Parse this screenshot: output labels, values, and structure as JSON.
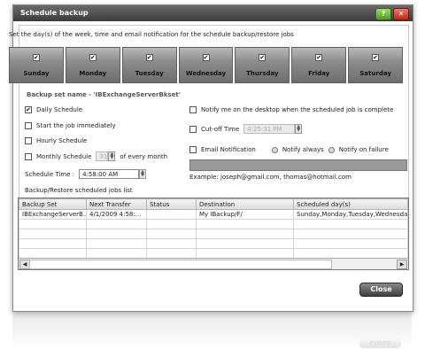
{
  "window": {
    "title": "Schedule backup",
    "help_label": "?",
    "close_label": "✕"
  },
  "intro": "Set the day(s) of the week, time and email notification for the schedule backup/restore jobs",
  "days": [
    {
      "label": "Sunday",
      "checked": true
    },
    {
      "label": "Monday",
      "checked": true
    },
    {
      "label": "Tuesday",
      "checked": true
    },
    {
      "label": "Wednesday",
      "checked": true
    },
    {
      "label": "Thursday",
      "checked": true
    },
    {
      "label": "Friday",
      "checked": true
    },
    {
      "label": "Saturday",
      "checked": true
    }
  ],
  "backup_set_name": "Backup set name - 'IBExchangeServerBkset'",
  "left_options": {
    "daily": {
      "label": "Daily Schedule",
      "checked": true
    },
    "immediately": {
      "label": "Start the job immediately",
      "checked": false
    },
    "hourly": {
      "label": "Hourly Schedule",
      "checked": false
    },
    "monthly": {
      "label": "Monthly Schedule",
      "checked": false,
      "day": "31",
      "suffix": "of every month"
    },
    "schedule_time": {
      "label": "Schedule Time :",
      "value": "4:58:00 AM"
    }
  },
  "right_options": {
    "notify_desktop": {
      "label": "Notify me on the desktop when the scheduled job is complete",
      "checked": false
    },
    "cutoff": {
      "label": "Cut-off Time",
      "checked": false,
      "value": "4:25:31 PM"
    },
    "email": {
      "label": "Email Notification",
      "checked": false
    },
    "notify_always": "Notify always",
    "notify_failure": "Notify on failure",
    "email_value": "",
    "email_example": "Example: joseph@gmail.com, thomas@hotmail.com"
  },
  "jobs": {
    "title": "Backup/Restore scheduled jobs list",
    "columns": [
      "Backup Set",
      "Next Transfer",
      "Status",
      "Destination",
      "Scheduled day(s)"
    ],
    "rows": [
      [
        "IBExchangeServerB...",
        "4/1/2009 4:58:...",
        "",
        "My IBackup/F/",
        "Sunday,Monday,Tuesday,Wednesday"
      ]
    ]
  },
  "buttons": {
    "close": "Close",
    "close_reflection": "Close"
  },
  "scroll": {
    "left": "◀",
    "right": "▶"
  },
  "check_mark": "✔"
}
